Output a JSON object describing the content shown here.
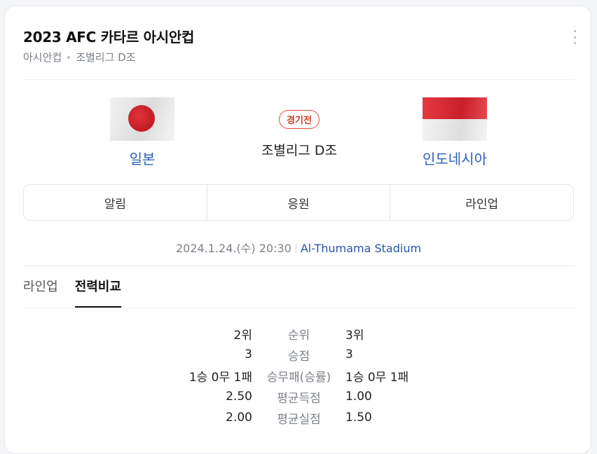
{
  "header": {
    "title": "2023 AFC 카타르 아시안컵",
    "league": "아시안컵",
    "stage": "조별리그 D조"
  },
  "match": {
    "home": {
      "name": "일본",
      "flag": "japan-flag"
    },
    "away": {
      "name": "인도네시아",
      "flag": "indonesia-flag"
    },
    "status": "경기전",
    "stage": "조별리그 D조",
    "datetime": "2024.1.24.(수) 20:30",
    "venue": "Al-Thumama Stadium"
  },
  "actions": [
    "알림",
    "응원",
    "라인업"
  ],
  "subtabs": [
    "라인업",
    "전력비교"
  ],
  "stats": [
    {
      "home": "2위",
      "label": "순위",
      "away": "3위"
    },
    {
      "home": "3",
      "label": "승점",
      "away": "3"
    },
    {
      "home": "1승 0무 1패",
      "label": "승무패(승률)",
      "away": "1승 0무 1패"
    },
    {
      "home": "2.50",
      "label": "평균득점",
      "away": "1.00"
    },
    {
      "home": "2.00",
      "label": "평균실점",
      "away": "1.50"
    }
  ],
  "colors": {
    "link": "#2a5fb8",
    "status": "#d83b22",
    "japan_red": "#bc002d",
    "indonesia_red": "#ce1126"
  }
}
